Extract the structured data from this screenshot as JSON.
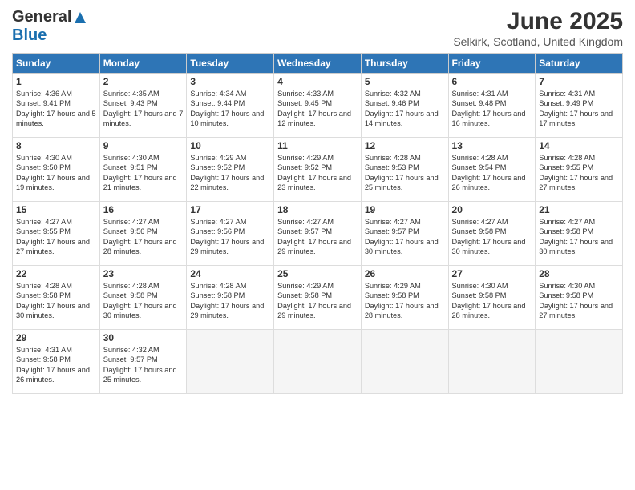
{
  "header": {
    "logo_general": "General",
    "logo_blue": "Blue",
    "month": "June 2025",
    "location": "Selkirk, Scotland, United Kingdom"
  },
  "weekdays": [
    "Sunday",
    "Monday",
    "Tuesday",
    "Wednesday",
    "Thursday",
    "Friday",
    "Saturday"
  ],
  "weeks": [
    [
      {
        "day": "1",
        "sunrise": "4:36 AM",
        "sunset": "9:41 PM",
        "daylight": "17 hours and 5 minutes."
      },
      {
        "day": "2",
        "sunrise": "4:35 AM",
        "sunset": "9:43 PM",
        "daylight": "17 hours and 7 minutes."
      },
      {
        "day": "3",
        "sunrise": "4:34 AM",
        "sunset": "9:44 PM",
        "daylight": "17 hours and 10 minutes."
      },
      {
        "day": "4",
        "sunrise": "4:33 AM",
        "sunset": "9:45 PM",
        "daylight": "17 hours and 12 minutes."
      },
      {
        "day": "5",
        "sunrise": "4:32 AM",
        "sunset": "9:46 PM",
        "daylight": "17 hours and 14 minutes."
      },
      {
        "day": "6",
        "sunrise": "4:31 AM",
        "sunset": "9:48 PM",
        "daylight": "17 hours and 16 minutes."
      },
      {
        "day": "7",
        "sunrise": "4:31 AM",
        "sunset": "9:49 PM",
        "daylight": "17 hours and 17 minutes."
      }
    ],
    [
      {
        "day": "8",
        "sunrise": "4:30 AM",
        "sunset": "9:50 PM",
        "daylight": "17 hours and 19 minutes."
      },
      {
        "day": "9",
        "sunrise": "4:30 AM",
        "sunset": "9:51 PM",
        "daylight": "17 hours and 21 minutes."
      },
      {
        "day": "10",
        "sunrise": "4:29 AM",
        "sunset": "9:52 PM",
        "daylight": "17 hours and 22 minutes."
      },
      {
        "day": "11",
        "sunrise": "4:29 AM",
        "sunset": "9:52 PM",
        "daylight": "17 hours and 23 minutes."
      },
      {
        "day": "12",
        "sunrise": "4:28 AM",
        "sunset": "9:53 PM",
        "daylight": "17 hours and 25 minutes."
      },
      {
        "day": "13",
        "sunrise": "4:28 AM",
        "sunset": "9:54 PM",
        "daylight": "17 hours and 26 minutes."
      },
      {
        "day": "14",
        "sunrise": "4:28 AM",
        "sunset": "9:55 PM",
        "daylight": "17 hours and 27 minutes."
      }
    ],
    [
      {
        "day": "15",
        "sunrise": "4:27 AM",
        "sunset": "9:55 PM",
        "daylight": "17 hours and 27 minutes."
      },
      {
        "day": "16",
        "sunrise": "4:27 AM",
        "sunset": "9:56 PM",
        "daylight": "17 hours and 28 minutes."
      },
      {
        "day": "17",
        "sunrise": "4:27 AM",
        "sunset": "9:56 PM",
        "daylight": "17 hours and 29 minutes."
      },
      {
        "day": "18",
        "sunrise": "4:27 AM",
        "sunset": "9:57 PM",
        "daylight": "17 hours and 29 minutes."
      },
      {
        "day": "19",
        "sunrise": "4:27 AM",
        "sunset": "9:57 PM",
        "daylight": "17 hours and 30 minutes."
      },
      {
        "day": "20",
        "sunrise": "4:27 AM",
        "sunset": "9:58 PM",
        "daylight": "17 hours and 30 minutes."
      },
      {
        "day": "21",
        "sunrise": "4:27 AM",
        "sunset": "9:58 PM",
        "daylight": "17 hours and 30 minutes."
      }
    ],
    [
      {
        "day": "22",
        "sunrise": "4:28 AM",
        "sunset": "9:58 PM",
        "daylight": "17 hours and 30 minutes."
      },
      {
        "day": "23",
        "sunrise": "4:28 AM",
        "sunset": "9:58 PM",
        "daylight": "17 hours and 30 minutes."
      },
      {
        "day": "24",
        "sunrise": "4:28 AM",
        "sunset": "9:58 PM",
        "daylight": "17 hours and 29 minutes."
      },
      {
        "day": "25",
        "sunrise": "4:29 AM",
        "sunset": "9:58 PM",
        "daylight": "17 hours and 29 minutes."
      },
      {
        "day": "26",
        "sunrise": "4:29 AM",
        "sunset": "9:58 PM",
        "daylight": "17 hours and 28 minutes."
      },
      {
        "day": "27",
        "sunrise": "4:30 AM",
        "sunset": "9:58 PM",
        "daylight": "17 hours and 28 minutes."
      },
      {
        "day": "28",
        "sunrise": "4:30 AM",
        "sunset": "9:58 PM",
        "daylight": "17 hours and 27 minutes."
      }
    ],
    [
      {
        "day": "29",
        "sunrise": "4:31 AM",
        "sunset": "9:58 PM",
        "daylight": "17 hours and 26 minutes."
      },
      {
        "day": "30",
        "sunrise": "4:32 AM",
        "sunset": "9:57 PM",
        "daylight": "17 hours and 25 minutes."
      },
      null,
      null,
      null,
      null,
      null
    ]
  ]
}
